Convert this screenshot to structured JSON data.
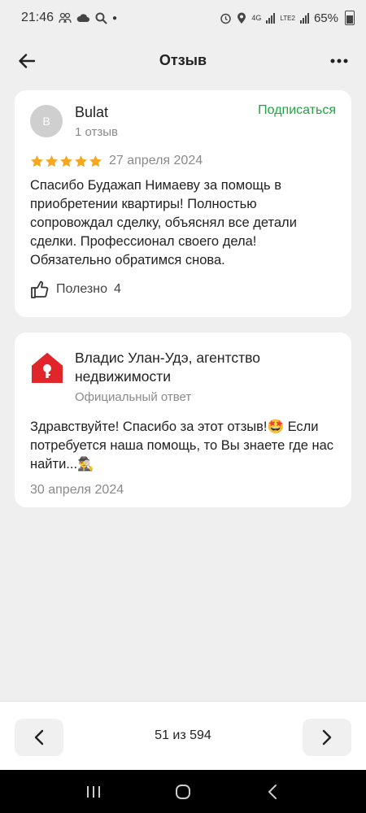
{
  "status_bar": {
    "time": "21:46",
    "battery": "65%",
    "network": "4G",
    "lte": "LTE2"
  },
  "header": {
    "title": "Отзыв"
  },
  "review": {
    "avatar_letter": "B",
    "author": "Bulat",
    "author_reviews": "1 отзыв",
    "subscribe_label": "Подписаться",
    "rating": 5,
    "date": "27 апреля 2024",
    "text": "Спасибо Будажап Нимаеву за помощь в приобретении квартиры! Полностью сопровождал сделку, объяснял все детали сделки. Профессионал своего дела! Обязательно обратимся снова.",
    "useful_label": "Полезно",
    "useful_count": "4"
  },
  "reply": {
    "company": "Владис Улан-Удэ, агентство недвижимости",
    "official_label": "Официальный ответ",
    "text": "Здравствуйте! Спасибо за этот отзыв!🤩 Если потребуется наша помощь, то Вы знаете где нас найти...🕵️‍♂️",
    "date": "30 апреля 2024"
  },
  "pager": {
    "label": "51 из 594"
  },
  "colors": {
    "accent_green": "#1fa542",
    "star": "#f5a623",
    "logo_red": "#e0262b"
  }
}
